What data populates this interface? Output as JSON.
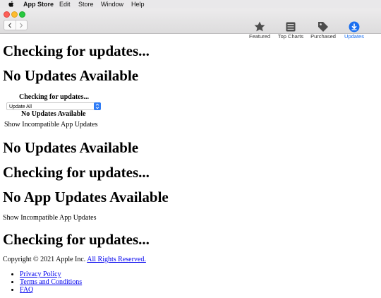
{
  "menubar": {
    "app_name": "App Store",
    "items": [
      "Edit",
      "Store",
      "Window",
      "Help"
    ]
  },
  "toolbar": {
    "items": [
      {
        "label": "Featured",
        "icon": "star-icon"
      },
      {
        "label": "Top Charts",
        "icon": "list-icon"
      },
      {
        "label": "Purchased",
        "icon": "tag-icon"
      },
      {
        "label": "Updates",
        "icon": "download-circle-icon",
        "active": true
      }
    ],
    "accent_color": "#1a6ff0"
  },
  "content": {
    "heading1": "Checking for updates...",
    "heading2": "No Updates Available",
    "widget_title": "Checking for updates...",
    "update_select_value": "Update All",
    "widget_status": "No Updates Available",
    "widget_incompatible": "Show Incompatible App Updates",
    "heading3": "No Updates Available",
    "heading4": "Checking for updates...",
    "heading5": "No App Updates Available",
    "incompatible_text": "Show Incompatible App Updates",
    "heading6": "Checking for updates...",
    "copyright_prefix": "Copyright © 2021 Apple Inc.",
    "rights_link": "All Rights Reserved.",
    "links": [
      "Privacy Policy",
      "Terms and Conditions",
      "FAQ"
    ]
  }
}
